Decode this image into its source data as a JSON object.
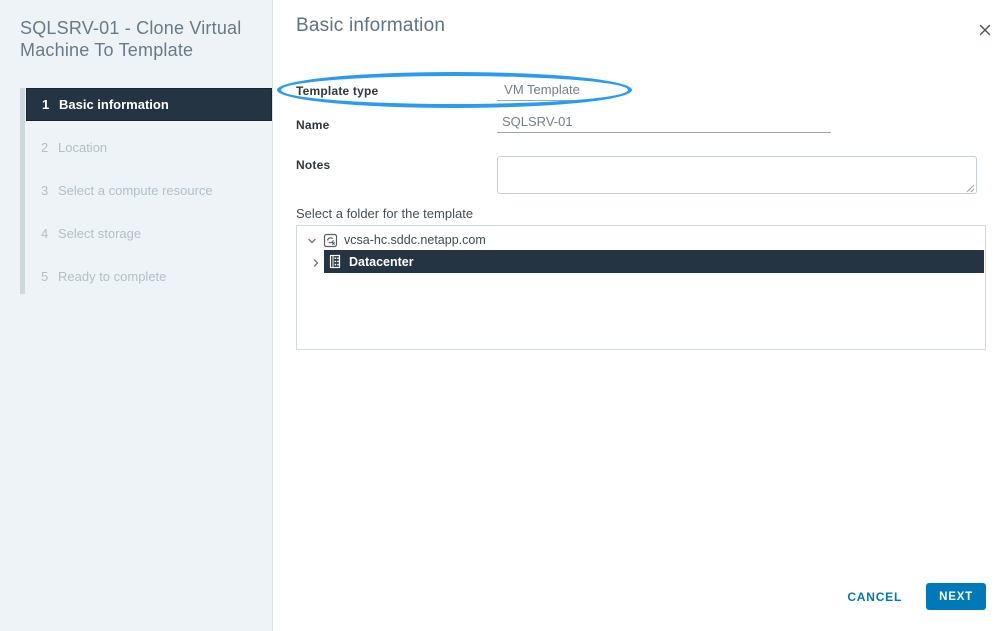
{
  "window": {
    "title": "SQLSRV-01 - Clone Virtual Machine To Template"
  },
  "sidebar": {
    "steps": [
      {
        "num": "1",
        "label": "Basic information",
        "state": "active"
      },
      {
        "num": "2",
        "label": "Location",
        "state": "upcoming"
      },
      {
        "num": "3",
        "label": "Select a compute resource",
        "state": "upcoming"
      },
      {
        "num": "4",
        "label": "Select storage",
        "state": "upcoming"
      },
      {
        "num": "5",
        "label": "Ready to complete",
        "state": "upcoming"
      }
    ]
  },
  "main": {
    "heading": "Basic information",
    "form": {
      "template_type_label": "Template type",
      "template_type_value": "VM Template",
      "name_label": "Name",
      "name_value": "SQLSRV-01",
      "notes_label": "Notes",
      "notes_value": "",
      "folder_section_label": "Select a folder for the template"
    },
    "tree": {
      "root": {
        "label": "vcsa-hc.sddc.netapp.com",
        "icon": "vcenter-server-icon",
        "expanded": true
      },
      "child": {
        "label": "Datacenter",
        "icon": "datacenter-icon",
        "selected": true,
        "expanded": false
      }
    },
    "annotation": {
      "shape": "ellipse",
      "highlights": "template-type-row"
    }
  },
  "footer": {
    "cancel_label": "CANCEL",
    "next_label": "NEXT"
  },
  "colors": {
    "accent_blue": "#0079b8",
    "annotation_blue": "#2b9bf2",
    "active_dark": "#243442",
    "sidebar_bg": "#eef3f7"
  }
}
